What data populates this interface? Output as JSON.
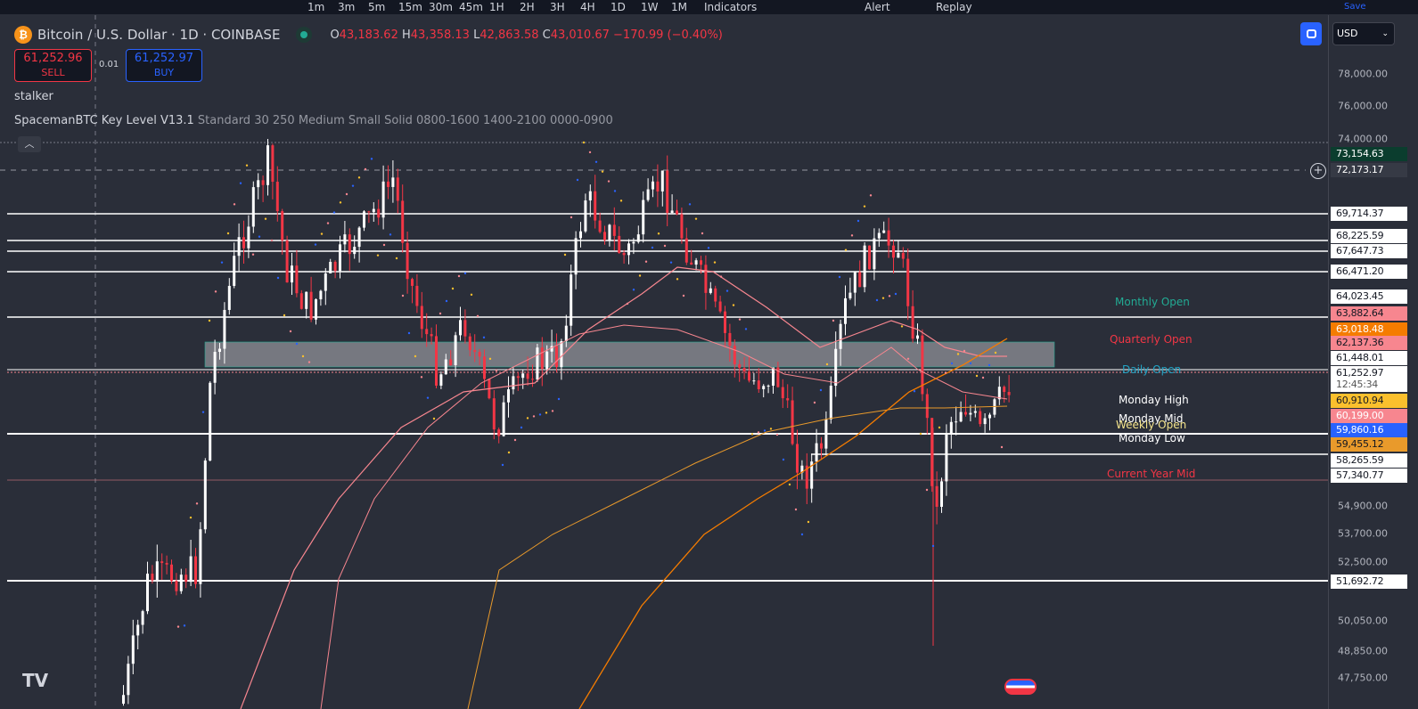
{
  "toolbar": {
    "intervals": [
      "1m",
      "3m",
      "5m",
      "15m",
      "30m",
      "45m",
      "1H",
      "2H",
      "3H",
      "4H",
      "1D",
      "1W",
      "1M"
    ],
    "indicators": "Indicators",
    "alert": "Alert",
    "replay": "Replay",
    "save": "Save"
  },
  "symbol": {
    "title": "Bitcoin / U.S. Dollar · 1D · COINBASE",
    "icon": "bitcoin-icon",
    "open_label": "O",
    "open": "43,183.62",
    "high_label": "H",
    "high": "43,358.13",
    "low_label": "L",
    "low": "42,863.58",
    "close_label": "C",
    "close": "43,010.67",
    "change": "−170.99 (−0.40%)"
  },
  "trade": {
    "sell_price": "61,252.96",
    "sell_label": "SELL",
    "spread": "0.01",
    "buy_price": "61,252.97",
    "buy_label": "BUY"
  },
  "indicators": [
    {
      "name": "stalker"
    },
    {
      "name": "SpacemanBTC Key Level V13.1",
      "params": "Standard 30 250 Medium Small Solid 0800-1600 1400-2100 0000-0900"
    }
  ],
  "currency": "USD",
  "axis_ticks": [
    "78,000.00",
    "76,000.00",
    "74,000.00",
    "54,900.00",
    "53,700.00",
    "52,500.00",
    "50,050.00",
    "48,850.00",
    "47,750.00"
  ],
  "price_labels": [
    {
      "v": "73,154.63",
      "bg": "#0b3d2e",
      "fg": "#ffffff"
    },
    {
      "v": "72,173.17",
      "bg": "#363a45",
      "fg": "#ffffff"
    },
    {
      "v": "69,714.37",
      "bg": "#ffffff",
      "fg": "#131722"
    },
    {
      "v": "68,225.59",
      "bg": "#ffffff",
      "fg": "#131722"
    },
    {
      "v": "67,647.73",
      "bg": "#ffffff",
      "fg": "#131722"
    },
    {
      "v": "66,471.20",
      "bg": "#ffffff",
      "fg": "#131722"
    },
    {
      "v": "64,023.45",
      "bg": "#ffffff",
      "fg": "#131722"
    },
    {
      "v": "63,882.64",
      "bg": "#f7868f",
      "fg": "#131722"
    },
    {
      "v": "63,018.48",
      "bg": "#f57c00",
      "fg": "#ffffff"
    },
    {
      "v": "62,137.36",
      "bg": "#f7868f",
      "fg": "#131722"
    },
    {
      "v": "61,448.01",
      "bg": "#ffffff",
      "fg": "#131722"
    },
    {
      "v": "61,252.97",
      "bg": "#ffffff",
      "fg": "#131722"
    },
    {
      "v": "12:45:34",
      "bg": "#ffffff",
      "fg": "#555555"
    },
    {
      "v": "60,910.94",
      "bg": "#fbc02d",
      "fg": "#131722"
    },
    {
      "v": "60,199.00",
      "bg": "#f7868f",
      "fg": "#ffffff"
    },
    {
      "v": "59,860.16",
      "bg": "#2962ff",
      "fg": "#ffffff"
    },
    {
      "v": "59,455.12",
      "bg": "#e99a2b",
      "fg": "#131722"
    },
    {
      "v": "58,265.59",
      "bg": "#ffffff",
      "fg": "#131722"
    },
    {
      "v": "57,340.77",
      "bg": "#ffffff",
      "fg": "#131722"
    },
    {
      "v": "51,692.72",
      "bg": "#ffffff",
      "fg": "#131722"
    }
  ],
  "levels": {
    "monthly_open": "Monthly Open",
    "quarterly_open": "Quarterly Open",
    "daily_open": "Daily Open",
    "monday_high": "Monday High",
    "monday_mid": "Monday Mid",
    "weekly_open": "Weekly Open",
    "monday_low": "Monday Low",
    "current_year_mid": "Current Year Mid"
  },
  "colors": {
    "up": "#ffffff",
    "down": "#f23645",
    "accent": "#2962ff",
    "green": "#22ab94"
  }
}
